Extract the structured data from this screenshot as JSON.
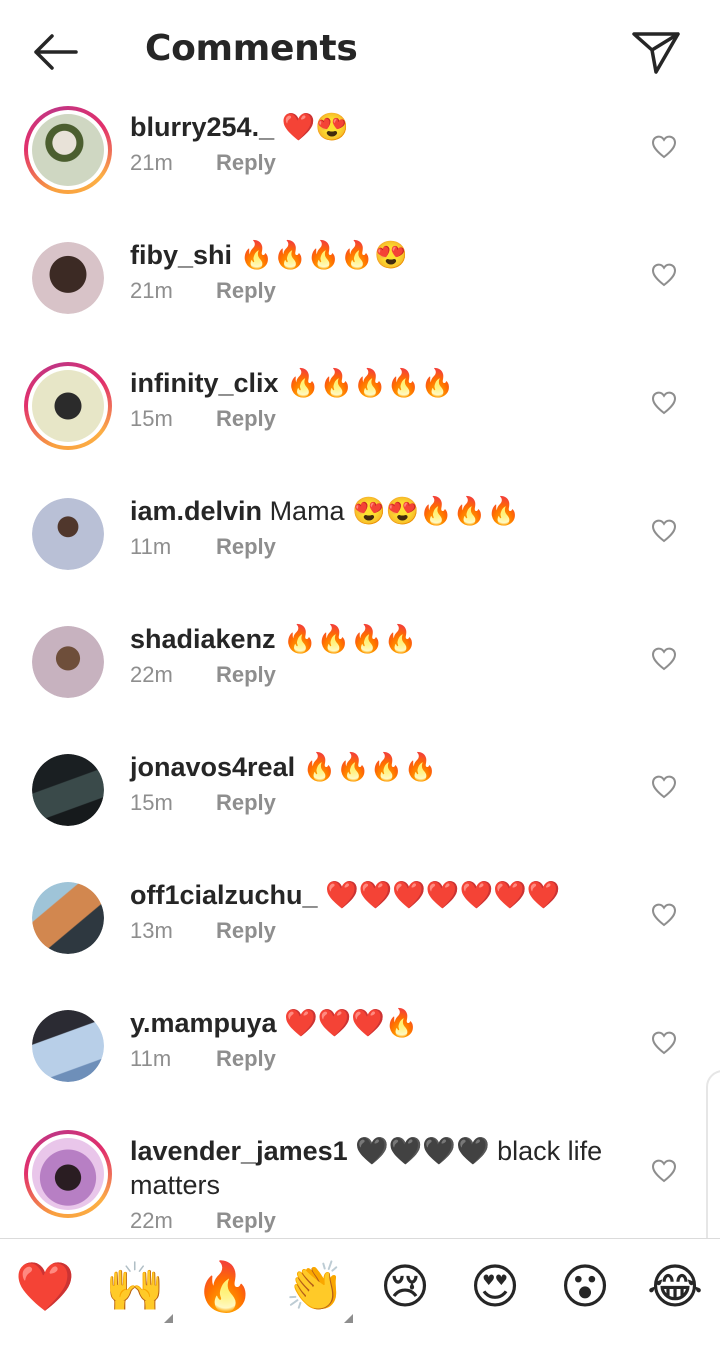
{
  "header": {
    "title": "Comments",
    "back_icon": "arrow-left-icon",
    "share_icon": "paper-plane-icon"
  },
  "colors": {
    "text": "#262626",
    "muted": "#8e8e8e",
    "divider": "#dbdbdb",
    "ring_start": "#f9a03f",
    "ring_end": "#e1306c"
  },
  "comments": [
    {
      "username": "blurry254._",
      "text": "❤️😍",
      "time": "21m",
      "reply": "Reply",
      "story_ring": true
    },
    {
      "username": "fiby_shi",
      "text": "🔥🔥🔥🔥😍",
      "time": "21m",
      "reply": "Reply",
      "story_ring": false
    },
    {
      "username": "infinity_clix",
      "text": "🔥🔥🔥🔥🔥",
      "time": "15m",
      "reply": "Reply",
      "story_ring": true
    },
    {
      "username": "iam.delvin",
      "text": "Mama 😍😍🔥🔥🔥",
      "time": "11m",
      "reply": "Reply",
      "story_ring": false
    },
    {
      "username": "shadiakenz",
      "text": "🔥🔥🔥🔥",
      "time": "22m",
      "reply": "Reply",
      "story_ring": false
    },
    {
      "username": "jonavos4real",
      "text": "🔥🔥🔥🔥",
      "time": "15m",
      "reply": "Reply",
      "story_ring": false
    },
    {
      "username": "off1cialzuchu_",
      "text": "❤️❤️❤️❤️❤️❤️❤️",
      "time": "13m",
      "reply": "Reply",
      "story_ring": false
    },
    {
      "username": "y.mampuya",
      "text": "❤️❤️❤️🔥",
      "time": "11m",
      "reply": "Reply",
      "story_ring": false
    },
    {
      "username": "lavender_james1",
      "text": "🖤🖤🖤🖤 black life matters",
      "time": "22m",
      "reply": "Reply",
      "story_ring": true
    }
  ],
  "emoji_bar": [
    {
      "emoji": "❤️",
      "has_variants": false
    },
    {
      "emoji": "🙌",
      "has_variants": true
    },
    {
      "emoji": "🔥",
      "has_variants": false
    },
    {
      "emoji": "👏",
      "has_variants": true
    },
    {
      "emoji": "😢",
      "has_variants": false
    },
    {
      "emoji": "😍",
      "has_variants": false
    },
    {
      "emoji": "😮",
      "has_variants": false
    },
    {
      "emoji": "😂",
      "has_variants": false
    }
  ]
}
